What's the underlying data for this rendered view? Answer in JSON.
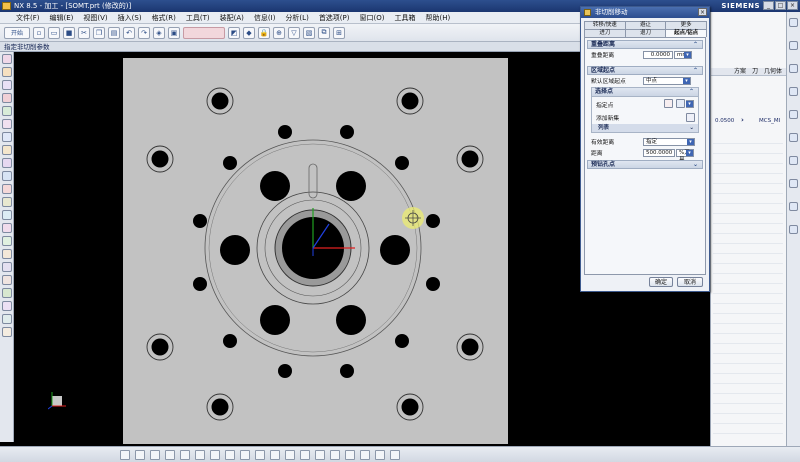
{
  "window": {
    "title": "NX 8.5 - 加工 - [SOMT.prt (修改的)]",
    "brand": "SIEMENS",
    "controls": [
      "_",
      "□",
      "×"
    ]
  },
  "menu": {
    "items": [
      "文件(F)",
      "编辑(E)",
      "视图(V)",
      "插入(S)",
      "格式(R)",
      "工具(T)",
      "装配(A)",
      "信息(I)",
      "分析(L)",
      "首选项(P)",
      "窗口(O)",
      "工具箱",
      "帮助(H)"
    ]
  },
  "toolbar": {
    "start_label": "开始"
  },
  "subtitle": "指定非切削参数",
  "dialog": {
    "title": "非切削移动",
    "close": "×",
    "tabs_row1": [
      "转移/快速",
      "避让",
      "更多"
    ],
    "tabs_row2": [
      "进刀",
      "退刀",
      "起点/钻点"
    ],
    "active_tab": "起点/钻点",
    "sec_overlap": {
      "header": "重叠距离",
      "label": "重叠距离",
      "value": "0.0000",
      "unit": "mm"
    },
    "sec_region_start": {
      "header": "区域起点",
      "default_label": "默认区域起点",
      "default_value": "中点",
      "select_points_header": "选择点",
      "specify_point_label": "指定点",
      "add_set_label": "添加新集",
      "list_label": "列表",
      "valid_distance_label": "有效距离",
      "valid_distance_value": "指定",
      "distance_label": "距离",
      "distance_value": "500.0000",
      "distance_unit": "%刀具"
    },
    "sec_predrill": {
      "header": "预钻孔点"
    },
    "ok_label": "确定",
    "cancel_label": "取消"
  },
  "right_panel": {
    "headers": [
      "方案",
      "刀",
      "几何体"
    ],
    "row_value": "0.0500",
    "row_mcs": "MCS_MI"
  },
  "colors": {
    "title_bar": "#1b3670",
    "plate": "#c2c2c2",
    "graphics_bg": "#000000",
    "wcs_x": "#e02020",
    "wcs_y": "#20a020",
    "wcs_z": "#2040e0",
    "cursor": "#ecec70"
  }
}
